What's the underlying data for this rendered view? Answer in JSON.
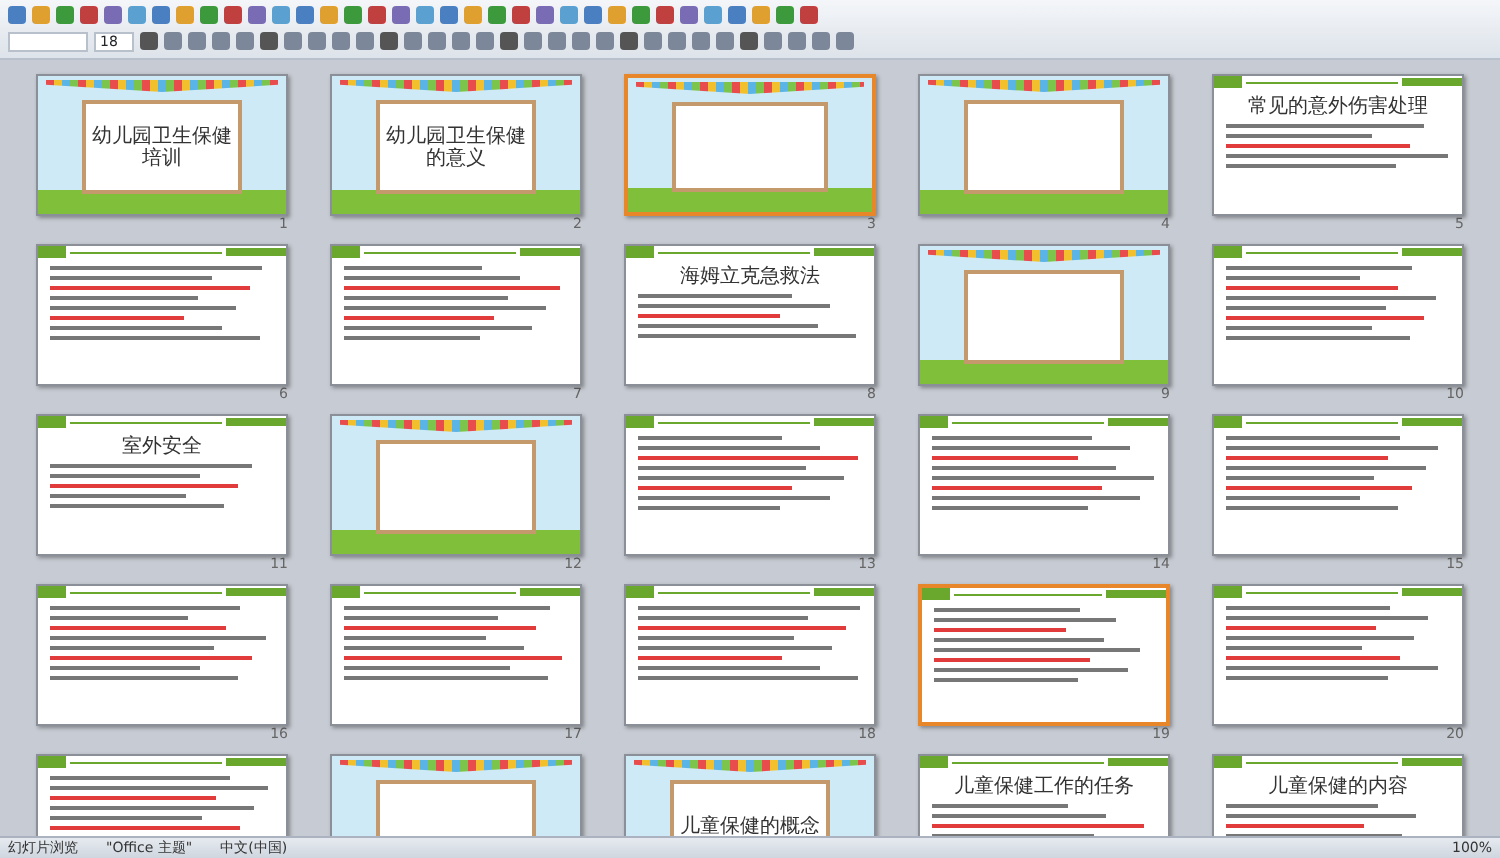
{
  "toolbar": {
    "font_size": "18"
  },
  "slides": [
    {
      "number": "1",
      "kind": "cartoon",
      "title": "幼儿园卫生保健培训",
      "selected": false
    },
    {
      "number": "2",
      "kind": "cartoon",
      "title": "幼儿园卫生保健的意义",
      "selected": false
    },
    {
      "number": "3",
      "kind": "cartoon",
      "selected": true
    },
    {
      "number": "4",
      "kind": "cartoon",
      "selected": false
    },
    {
      "number": "5",
      "kind": "content",
      "title": "常见的意外伤害处理",
      "selected": false
    },
    {
      "number": "6",
      "kind": "content",
      "selected": false
    },
    {
      "number": "7",
      "kind": "content",
      "selected": false
    },
    {
      "number": "8",
      "kind": "content",
      "title": "海姆立克急救法",
      "selected": false
    },
    {
      "number": "9",
      "kind": "cartoon",
      "selected": false
    },
    {
      "number": "10",
      "kind": "content",
      "selected": false
    },
    {
      "number": "11",
      "kind": "content",
      "title": "室外安全",
      "selected": false
    },
    {
      "number": "12",
      "kind": "cartoon",
      "selected": false
    },
    {
      "number": "13",
      "kind": "content",
      "selected": false
    },
    {
      "number": "14",
      "kind": "content",
      "selected": false
    },
    {
      "number": "15",
      "kind": "content",
      "selected": false
    },
    {
      "number": "16",
      "kind": "content",
      "selected": false
    },
    {
      "number": "17",
      "kind": "content",
      "selected": false
    },
    {
      "number": "18",
      "kind": "content",
      "selected": false
    },
    {
      "number": "19",
      "kind": "content",
      "selected": true
    },
    {
      "number": "20",
      "kind": "content",
      "selected": false
    },
    {
      "kind": "content",
      "selected": false
    },
    {
      "kind": "cartoon",
      "selected": false
    },
    {
      "kind": "cartoon",
      "title": "儿童保健的概念",
      "selected": false
    },
    {
      "kind": "content",
      "title": "儿童保健工作的任务",
      "selected": false
    },
    {
      "kind": "content",
      "title": "儿童保健的内容",
      "selected": false
    }
  ],
  "status_bar": {
    "view": "幻灯片浏览",
    "theme": "\"Office 主题\"",
    "language": "中文(中国)",
    "zoom": "100%"
  }
}
